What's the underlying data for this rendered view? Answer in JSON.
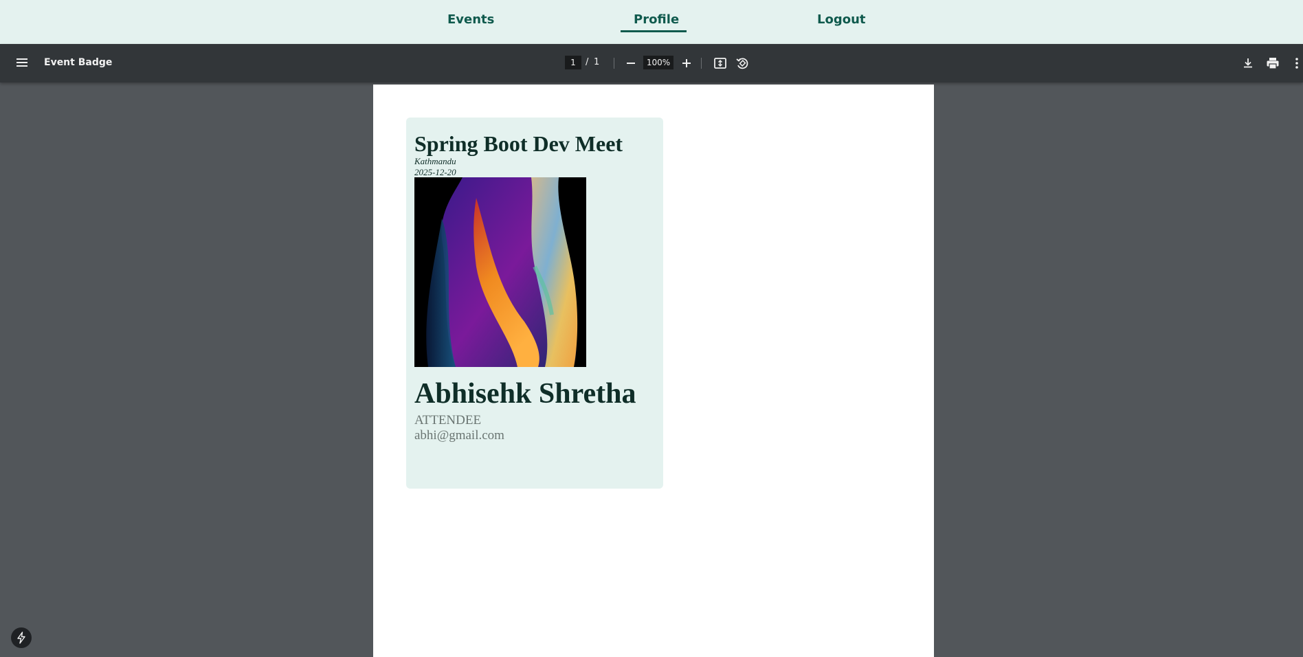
{
  "nav": {
    "events_label": "Events",
    "profile_label": "Profile",
    "logout_label": "Logout",
    "accent_color": "#0f5a4d"
  },
  "viewer": {
    "title": "Event Badge",
    "current_page": "1",
    "page_separator": "/",
    "total_pages": "1",
    "zoom": "100%",
    "icons": [
      "menu-icon",
      "zoom-out-icon",
      "zoom-in-icon",
      "fit-page-icon",
      "rotate-icon",
      "download-icon",
      "print-icon",
      "more-vert-icon"
    ]
  },
  "badge": {
    "event_name": "Spring Boot Dev Meet",
    "location": "Kathmandu",
    "date": "2025-12-20",
    "attendee_name": "Abhisehk Shretha",
    "role": "ATTENDEE",
    "email": "abhi@gmail.com",
    "background_color": "#e4f2ef"
  },
  "floating": {
    "icon": "bolt-icon"
  }
}
